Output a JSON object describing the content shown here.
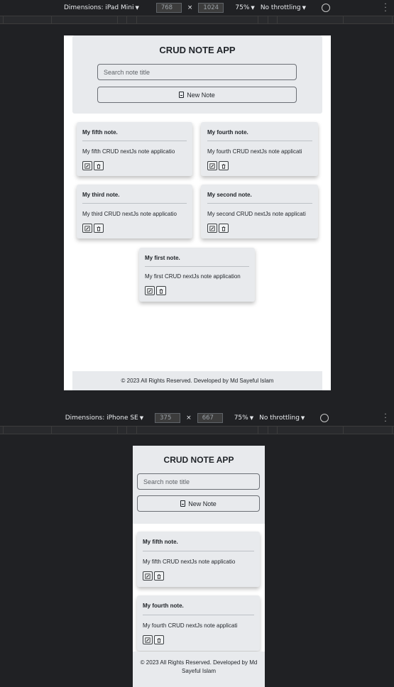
{
  "ipad": {
    "device_label": "Dimensions: iPad Mini",
    "width": "768",
    "height": "1024",
    "times": "×",
    "zoom": "75%",
    "throttle": "No throttling"
  },
  "iphone": {
    "device_label": "Dimensions: iPhone SE",
    "width": "375",
    "height": "667",
    "times": "×",
    "zoom": "75%",
    "throttle": "No throttling"
  },
  "app": {
    "title": "CRUD NOTE APP",
    "search_placeholder": "Search note title",
    "new_note_label": "New Note",
    "footer": "© 2023 All Rights Reserved. Developed by Md Sayeful Islam",
    "footer_line1": "© 2023 All Rights Reserved. Developed by Md",
    "footer_line2": "Sayeful Islam"
  },
  "notes": [
    {
      "title": "My fifth note.",
      "body": "My fifth CRUD nextJs note applicatio"
    },
    {
      "title": "My fourth note.",
      "body": "My fourth CRUD nextJs note applicati"
    },
    {
      "title": "My third note.",
      "body": "My third CRUD nextJs note applicatio"
    },
    {
      "title": "My second note.",
      "body": "My second CRUD nextJs note applicati"
    },
    {
      "title": "My first note.",
      "body": "My first CRUD nextJs note application"
    }
  ],
  "icons": {
    "edit": "edit-icon",
    "delete": "trash-icon",
    "new": "document-icon"
  }
}
